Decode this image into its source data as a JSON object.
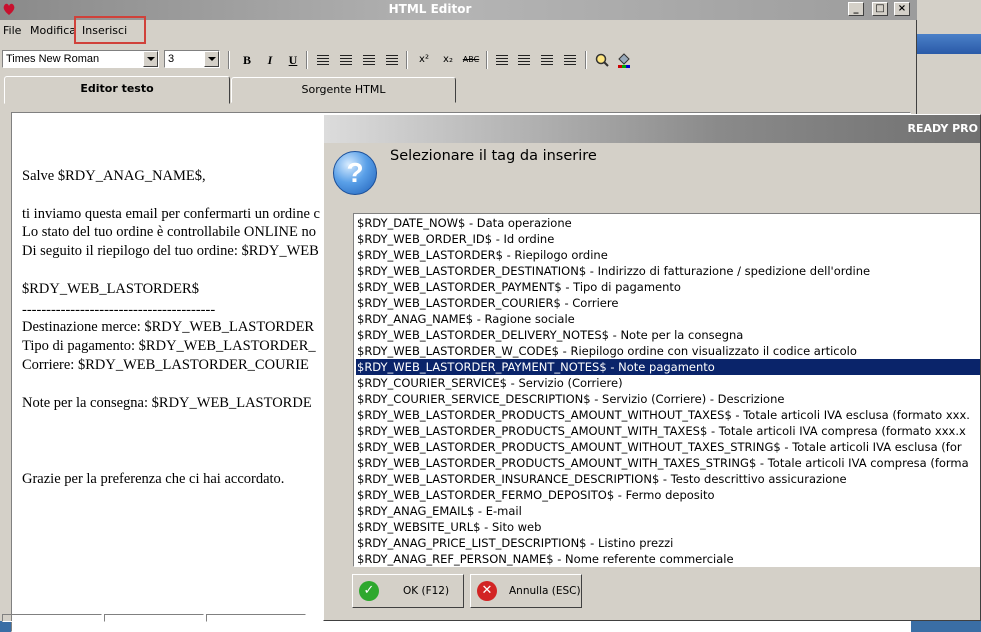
{
  "window": {
    "title": "HTML Editor"
  },
  "menu": {
    "items": [
      "File",
      "Modifica",
      "Inserisci"
    ]
  },
  "toolbar": {
    "font_family": "Times New Roman",
    "font_size": "3",
    "bold": "B",
    "italic": "I",
    "underline": "U",
    "superscript": "x²",
    "subscript": "x₂",
    "spellcheck": "ABC"
  },
  "tabs": [
    "Editor testo",
    "Sorgente HTML"
  ],
  "editor": {
    "lines": [
      "Salve $RDY_ANAG_NAME$,",
      "ti inviamo questa email per confermarti un ordine c",
      "Lo stato del tuo ordine è controllabile ONLINE no",
      "Di seguito il riepilogo del tuo ordine: $RDY_WEB",
      "$RDY_WEB_LASTORDER$",
      "----------------------------------------",
      "Destinazione merce: $RDY_WEB_LASTORDER",
      "Tipo di pagamento: $RDY_WEB_LASTORDER_",
      "Corriere: $RDY_WEB_LASTORDER_COURIE",
      "Note per la consegna: $RDY_WEB_LASTORDE",
      "Grazie per la preferenza che ci hai accordato."
    ]
  },
  "dialog": {
    "title": "READY PRO",
    "heading": "Selezionare il tag da inserire",
    "selected_index": 9,
    "items": [
      "$RDY_DATE_NOW$ - Data operazione",
      "$RDY_WEB_ORDER_ID$ - Id ordine",
      "$RDY_WEB_LASTORDER$ - Riepilogo ordine",
      "$RDY_WEB_LASTORDER_DESTINATION$ - Indirizzo di fatturazione / spedizione dell'ordine",
      "$RDY_WEB_LASTORDER_PAYMENT$ - Tipo di pagamento",
      "$RDY_WEB_LASTORDER_COURIER$ - Corriere",
      "$RDY_ANAG_NAME$ - Ragione sociale",
      "$RDY_WEB_LASTORDER_DELIVERY_NOTES$ - Note per la consegna",
      "$RDY_WEB_LASTORDER_W_CODE$ - Riepilogo ordine con visualizzato il codice articolo",
      "$RDY_WEB_LASTORDER_PAYMENT_NOTES$ - Note pagamento",
      "$RDY_COURIER_SERVICE$ - Servizio (Corriere)",
      "$RDY_COURIER_SERVICE_DESCRIPTION$ - Servizio (Corriere) - Descrizione",
      "$RDY_WEB_LASTORDER_PRODUCTS_AMOUNT_WITHOUT_TAXES$ - Totale articoli IVA esclusa (formato xxx.",
      "$RDY_WEB_LASTORDER_PRODUCTS_AMOUNT_WITH_TAXES$ - Totale articoli IVA compresa (formato xxx.x",
      "$RDY_WEB_LASTORDER_PRODUCTS_AMOUNT_WITHOUT_TAXES_STRING$ - Totale articoli IVA esclusa (for",
      "$RDY_WEB_LASTORDER_PRODUCTS_AMOUNT_WITH_TAXES_STRING$ - Totale articoli IVA compresa (forma",
      "$RDY_WEB_LASTORDER_INSURANCE_DESCRIPTION$ - Testo descrittivo assicurazione",
      "$RDY_WEB_LASTORDER_FERMO_DEPOSITO$ - Fermo deposito",
      "$RDY_ANAG_EMAIL$ - E-mail",
      "$RDY_WEBSITE_URL$ - Sito web",
      "$RDY_ANAG_PRICE_LIST_DESCRIPTION$ - Listino prezzi",
      "$RDY_ANAG_REF_PERSON_NAME$ - Nome referente commerciale"
    ],
    "ok_label": "OK (F12)",
    "cancel_label": "Annulla (ESC)"
  },
  "colors": {
    "selection": "#0a246a",
    "highlight_box": "#d0413a",
    "window_face": "#d4d0c8"
  }
}
